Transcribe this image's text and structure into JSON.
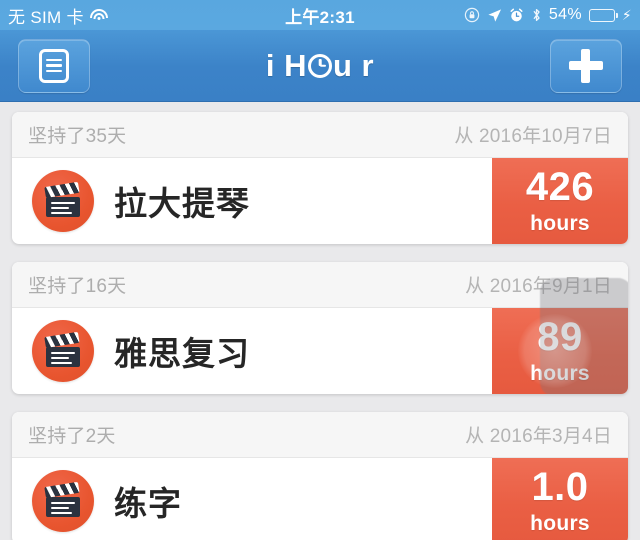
{
  "status_bar": {
    "carrier": "无 SIM 卡",
    "wifi_icon": "wifi-icon",
    "time": "上午2:31",
    "rotation_lock_icon": "rotation-lock-icon",
    "location_icon": "location-arrow-icon",
    "alarm_icon": "alarm-clock-icon",
    "bluetooth_icon": "bluetooth-icon",
    "battery_percent": "54%",
    "battery_fill_pct": 54,
    "battery_color": "#4cd55a",
    "charging_bolt_icon": "lightning-bolt-icon"
  },
  "nav": {
    "menu_icon": "list-icon",
    "add_icon": "plus-icon",
    "title_pre": "i H",
    "title_clock_icon": "clock-icon",
    "title_post": "u r",
    "title_full": "iHour",
    "bar_color": "#3c83c8"
  },
  "theme": {
    "accent": "#ea5f44",
    "avatar": "#e8552f",
    "background": "#e9e9eb",
    "card": "#ffffff",
    "card_header": "#f6f6f6",
    "muted_text": "#adadad"
  },
  "items": [
    {
      "days_label": "坚持了35天",
      "since_label": "从 2016年10月7日",
      "icon": "clapperboard-icon",
      "title": "拉大提琴",
      "hours": "426",
      "unit": "hours",
      "overlay": false
    },
    {
      "days_label": "坚持了16天",
      "since_label": "从 2016年9月1日",
      "icon": "clapperboard-icon",
      "title": "雅思复习",
      "hours": "89",
      "unit": "hours",
      "overlay": true
    },
    {
      "days_label": "坚持了2天",
      "since_label": "从 2016年3月4日",
      "icon": "clapperboard-icon",
      "title": "练字",
      "hours": "1.0",
      "unit": "hours",
      "overlay": false
    }
  ]
}
